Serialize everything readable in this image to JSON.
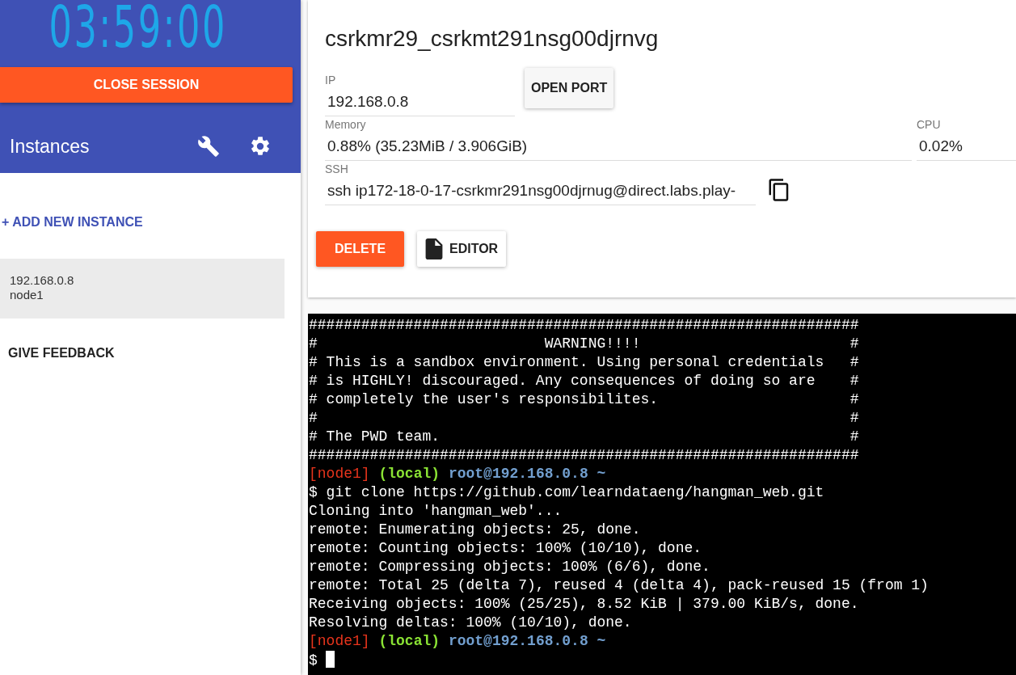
{
  "sidebar": {
    "timer": "03:59:00",
    "close_button": "CLOSE SESSION",
    "title": "Instances",
    "add_instance": "+ ADD NEW INSTANCE",
    "instances": [
      {
        "ip": "192.168.0.8",
        "name": "node1",
        "selected": true
      }
    ],
    "feedback": "GIVE FEEDBACK"
  },
  "details": {
    "title": "csrkmr29_csrkmt291nsg00djrnvg",
    "fields": [
      {
        "label": "IP",
        "value": "192.168.0.8"
      },
      {
        "label": "Memory",
        "value": "0.88% (35.23MiB / 3.906GiB)"
      },
      {
        "label": "CPU",
        "value": "0.02%"
      },
      {
        "label": "SSH",
        "value": "ssh ip172-18-0-17-csrkmr291nsg00djrnug@direct.labs.play-"
      }
    ],
    "open_port_button": "OPEN PORT",
    "delete_button": "DELETE",
    "editor_button": "EDITOR"
  },
  "terminal": {
    "lines": [
      {
        "kind": "text",
        "text": "###############################################################"
      },
      {
        "kind": "text",
        "text": "#                          WARNING!!!!                        #"
      },
      {
        "kind": "text",
        "text": "# This is a sandbox environment. Using personal credentials   #"
      },
      {
        "kind": "text",
        "text": "# is HIGHLY! discouraged. Any consequences of doing so are    #"
      },
      {
        "kind": "text",
        "text": "# completely the user's responsibilites.                      #"
      },
      {
        "kind": "text",
        "text": "#                                                             #"
      },
      {
        "kind": "text",
        "text": "# The PWD team.                                               #"
      },
      {
        "kind": "text",
        "text": "###############################################################"
      },
      {
        "kind": "prompt",
        "node": "[node1]",
        "env": "(local)",
        "host": "root@192.168.0.8",
        "dir": "~"
      },
      {
        "kind": "text",
        "text": "$ git clone https://github.com/learndataeng/hangman_web.git"
      },
      {
        "kind": "text",
        "text": "Cloning into 'hangman_web'..."
      },
      {
        "kind": "text",
        "text": "remote: Enumerating objects: 25, done."
      },
      {
        "kind": "text",
        "text": "remote: Counting objects: 100% (10/10), done."
      },
      {
        "kind": "text",
        "text": "remote: Compressing objects: 100% (6/6), done."
      },
      {
        "kind": "text",
        "text": "remote: Total 25 (delta 7), reused 4 (delta 4), pack-reused 15 (from 1)"
      },
      {
        "kind": "text",
        "text": "Receiving objects: 100% (25/25), 8.52 KiB | 379.00 KiB/s, done."
      },
      {
        "kind": "text",
        "text": "Resolving deltas: 100% (10/10), done."
      },
      {
        "kind": "prompt",
        "node": "[node1]",
        "env": "(local)",
        "host": "root@192.168.0.8",
        "dir": "~"
      },
      {
        "kind": "input",
        "text": "$"
      }
    ]
  }
}
